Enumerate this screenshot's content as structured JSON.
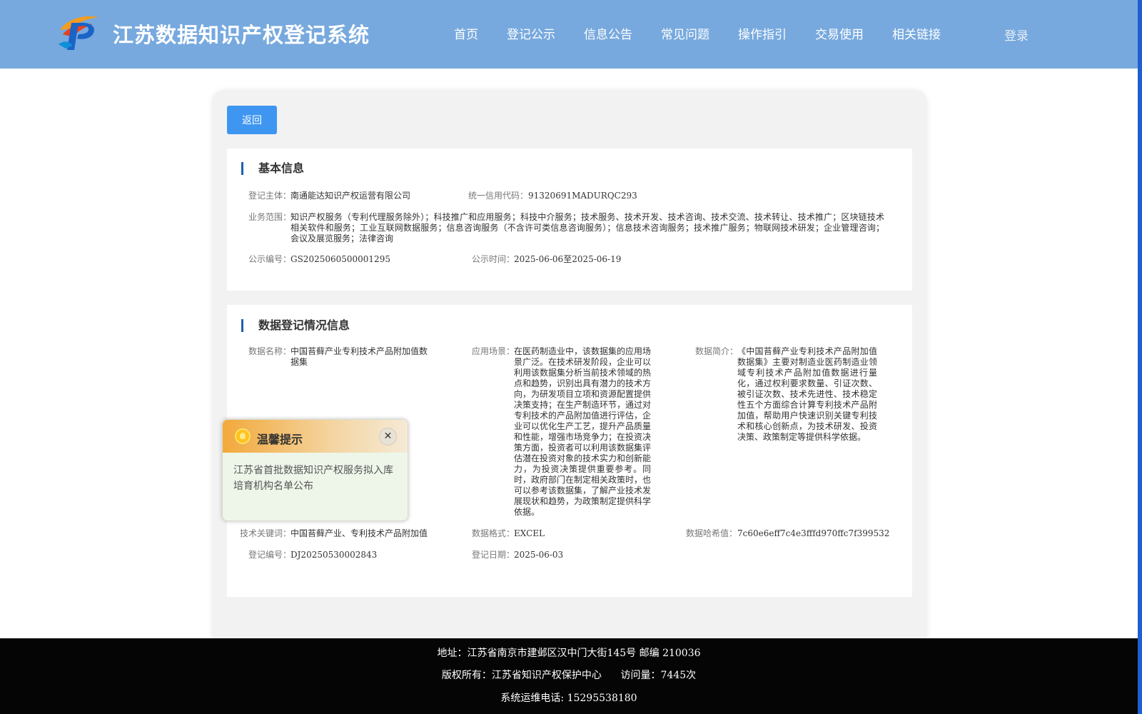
{
  "header": {
    "site_title": "江苏数据知识产权登记系统",
    "logo_icon": "ip-logo-icon",
    "nav": [
      "首页",
      "登记公示",
      "信息公告",
      "常见问题",
      "操作指引",
      "交易使用",
      "相关链接"
    ],
    "login_label": "登录"
  },
  "toolbar": {
    "back_label": "返回"
  },
  "basic_info": {
    "title": "基本信息",
    "registrant_label": "登记主体：",
    "registrant": "南通能达知识产权运营有限公司",
    "credit_code_label": "统一信用代码：",
    "credit_code": "91320691MADURQC293",
    "scope_label": "业务范围：",
    "scope": "知识产权服务（专利代理服务除外）；科技推广和应用服务；科技中介服务；技术服务、技术开发、技术咨询、技术交流、技术转让、技术推广；区块链技术相关软件和服务；工业互联网数据服务；信息咨询服务（不含许可类信息咨询服务）；信息技术咨询服务；技术推广服务；物联网技术研发；企业管理咨询；会议及展览服务；法律咨询",
    "notice_no_label": "公示编号：",
    "notice_no": "GS2025060500001295",
    "notice_time_label": "公示时间：",
    "notice_time": "2025-06-06至2025-06-19"
  },
  "data_info": {
    "title": "数据登记情况信息",
    "name_label": "数据名称：",
    "name": "中国苔藓产业专利技术产品附加值数据集",
    "scenario_label": "应用场景：",
    "scenario": "在医药制造业中，该数据集的应用场景广泛。在技术研发阶段，企业可以利用该数据集分析当前技术领域的热点和趋势，识别出具有潜力的技术方向，为研发项目立项和资源配置提供决策支持；在生产制造环节，通过对专利技术的产品附加值进行评估，企业可以优化生产工艺，提升产品质量和性能，增强市场竞争力；在投资决策方面，投资者可以利用该数据集评估潜在投资对象的技术实力和创新能力，为投资决策提供重要参考。同时，政府部门在制定相关政策时，也可以参考该数据集，了解产业技术发展现状和趋势，为政策制定提供科学依据。",
    "intro_label": "数据简介：",
    "intro": "《中国苔藓产业专利技术产品附加值数据集》主要对制造业医药制造业领域专利技术产品附加值数据进行量化，通过权利要求数量、引证次数、被引证次数、技术先进性、技术稳定性五个方面综合计算专利技术产品附加值，帮助用户快速识别关键专利技术和核心创新点，为技术研发、投资决策、政策制定等提供科学依据。",
    "keywords_label": "技术关键词：",
    "keywords": "中国苔藓产业、专利技术产品附加值",
    "format_label": "数据格式：",
    "format": "EXCEL",
    "hash_label": "数据哈希值：",
    "hash": "7c60e6eff7c4e3fffd970ffc7f399532",
    "reg_no_label": "登记编号：",
    "reg_no": "DJ20250530002843",
    "reg_date_label": "登记日期：",
    "reg_date": "2025-06-03"
  },
  "popup": {
    "icon": "lightbulb-icon",
    "title": "温馨提示",
    "close_icon": "close-icon",
    "message": "江苏省首批数据知识产权服务拟入库培育机构名单公布"
  },
  "footer": {
    "address": "地址：江苏省南京市建邺区汉中门大街145号 邮编 210036",
    "copyright": "版权所有：江苏省知识产权保护中心      访问量：7445次",
    "phone": "系统运维电话: 15295538180"
  },
  "colors": {
    "header_bg": "#77a9de",
    "accent_blue": "#3e96f1",
    "section_bar": "#1f5fb0",
    "footer_bg": "#050505"
  }
}
